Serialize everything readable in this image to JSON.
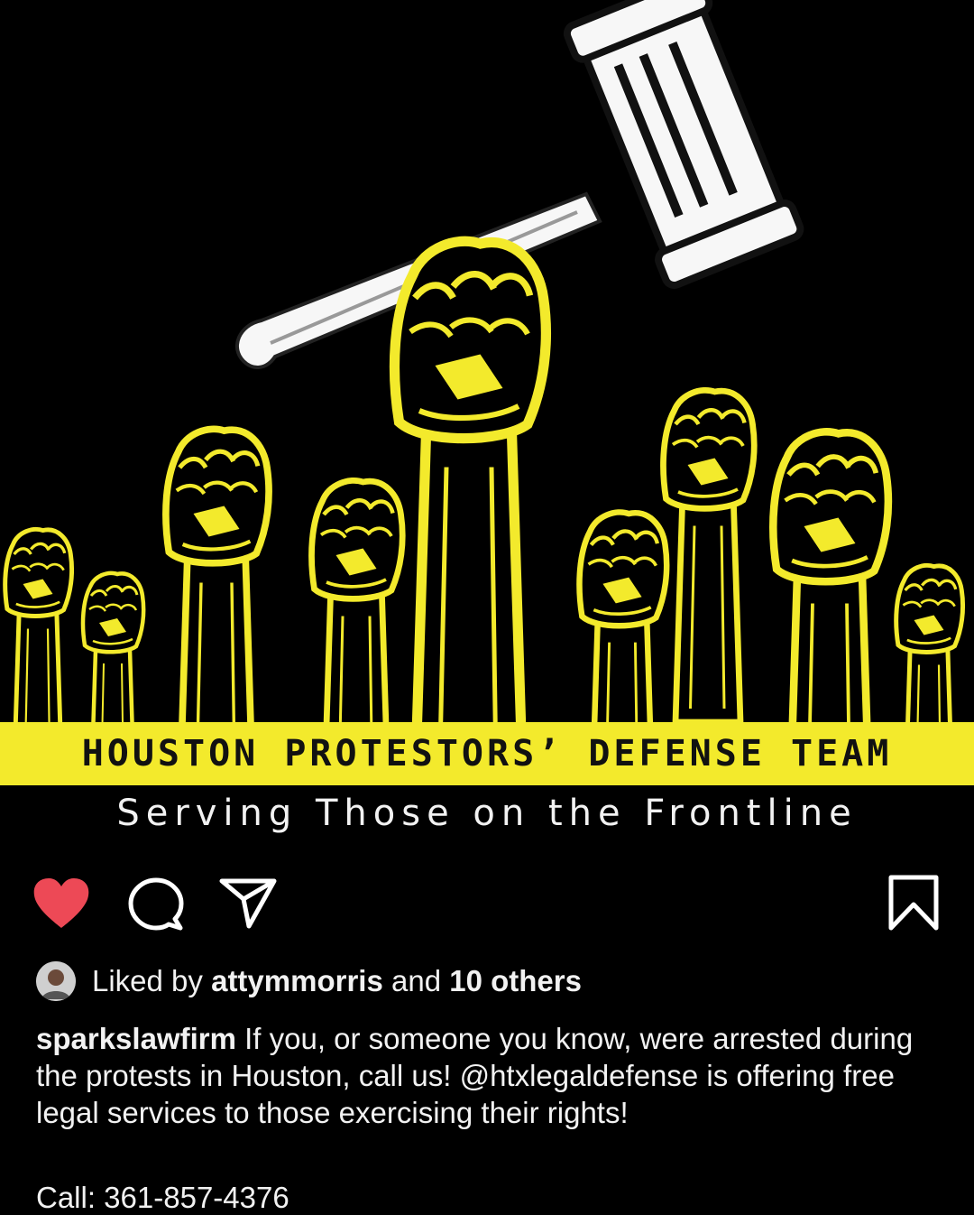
{
  "post": {
    "banner_title": "HOUSTON PROTESTORS’ DEFENSE TEAM",
    "tagline": "Serving Those on the Frontline",
    "colors": {
      "accent_yellow": "#f3ea2c",
      "like_red": "#ed4956",
      "background": "#000000"
    }
  },
  "actions": {
    "like_icon": "heart-filled-icon",
    "comment_icon": "comment-bubble-icon",
    "share_icon": "paper-plane-icon",
    "save_icon": "bookmark-icon"
  },
  "likes": {
    "prefix": "Liked by",
    "user": "attymmorris",
    "middle": "and",
    "others": "10 others"
  },
  "caption": {
    "username": "sparkslawfirm",
    "text": "If you, or someone you know, were arrested during the protests in Houston, call us! @htxlegaldefense is offering free legal services to those exercising their rights!",
    "phone": "Call: 361-857-4376"
  }
}
